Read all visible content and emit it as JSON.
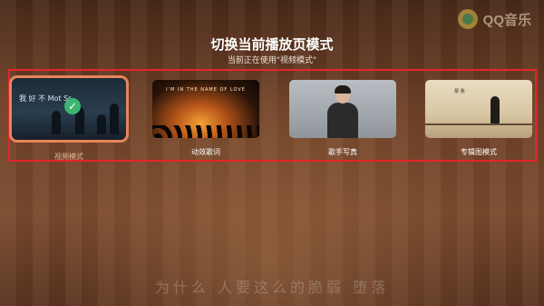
{
  "app": {
    "logo_text": "QQ音乐"
  },
  "dialog": {
    "title": "切换当前播放页模式",
    "subtitle": "当前正在使用\"视频模式\""
  },
  "modes": [
    {
      "label": "视频模式",
      "selected": true,
      "thumbnail_text": "我 好 不 Mot Sr"
    },
    {
      "label": "动效歌词",
      "selected": false,
      "thumbnail_text": "I'M IN THE NAME OF LOVE"
    },
    {
      "label": "歌手写真",
      "selected": false
    },
    {
      "label": "专辑图模式",
      "selected": false,
      "thumbnail_text": "那 我 ·"
    }
  ],
  "background_lyric": "为什么 人要这么的脆弱 堕落",
  "colors": {
    "selection_frame": "#e3262a",
    "selected_border": "#e7845c",
    "check": "#3db470"
  },
  "icons": {
    "logo": "qq-music-logo-icon",
    "selected": "check-icon"
  }
}
